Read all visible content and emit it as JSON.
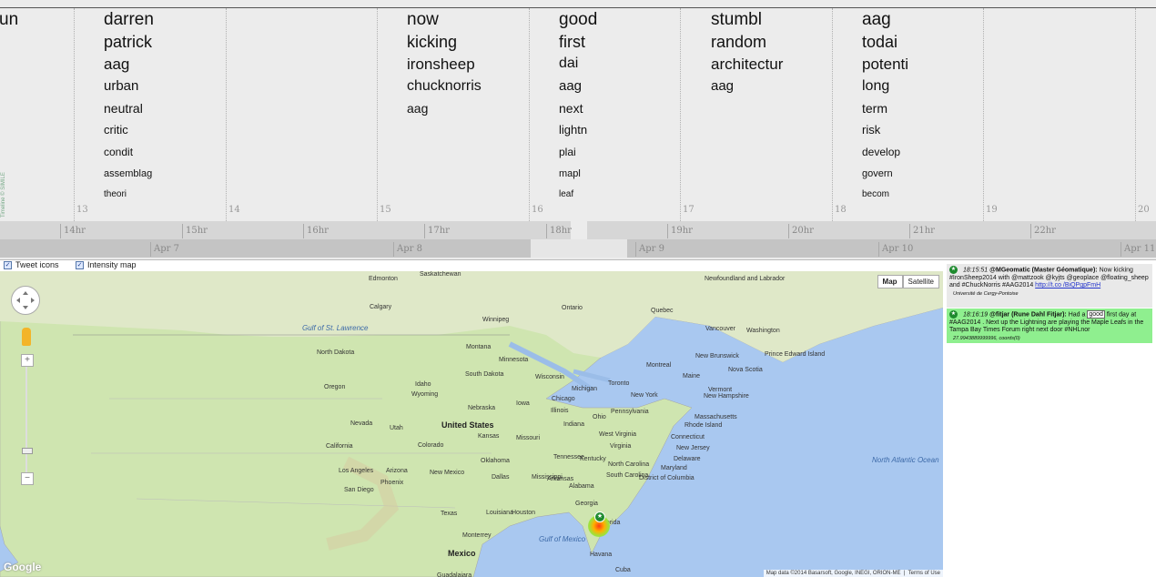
{
  "timeline": {
    "columns": [
      {
        "words": [
          {
            "text": "un",
            "size": 19
          }
        ]
      },
      {
        "words": [
          {
            "text": "darren",
            "size": 19
          },
          {
            "text": "patrick",
            "size": 18
          },
          {
            "text": "aag",
            "size": 17
          },
          {
            "text": "urban",
            "size": 15
          },
          {
            "text": "neutral",
            "size": 14
          },
          {
            "text": "critic",
            "size": 13
          },
          {
            "text": "condit",
            "size": 12
          },
          {
            "text": "assemblag",
            "size": 11
          },
          {
            "text": "theori",
            "size": 10
          }
        ]
      },
      {
        "words": []
      },
      {
        "words": [
          {
            "text": "now",
            "size": 19
          },
          {
            "text": "kicking",
            "size": 18
          },
          {
            "text": "ironsheep",
            "size": 17
          },
          {
            "text": "chucknorris",
            "size": 16
          },
          {
            "text": "aag",
            "size": 14
          }
        ]
      },
      {
        "words": [
          {
            "text": "good",
            "size": 19
          },
          {
            "text": "first",
            "size": 18
          },
          {
            "text": "dai",
            "size": 16
          },
          {
            "text": "aag",
            "size": 15
          },
          {
            "text": "next",
            "size": 14
          },
          {
            "text": "lightn",
            "size": 13
          },
          {
            "text": "plai",
            "size": 12
          },
          {
            "text": "mapl",
            "size": 11
          },
          {
            "text": "leaf",
            "size": 10
          }
        ]
      },
      {
        "words": [
          {
            "text": "stumbl",
            "size": 19
          },
          {
            "text": "random",
            "size": 18
          },
          {
            "text": "architectur",
            "size": 17
          },
          {
            "text": "aag",
            "size": 15
          }
        ]
      },
      {
        "words": [
          {
            "text": "aag",
            "size": 19
          },
          {
            "text": "todai",
            "size": 18
          },
          {
            "text": "potenti",
            "size": 17
          },
          {
            "text": "long",
            "size": 16
          },
          {
            "text": "term",
            "size": 14
          },
          {
            "text": "risk",
            "size": 13
          },
          {
            "text": "develop",
            "size": 12
          },
          {
            "text": "govern",
            "size": 11
          },
          {
            "text": "becom",
            "size": 10
          }
        ]
      }
    ],
    "day_numbers": [
      "13",
      "14",
      "15",
      "16",
      "17",
      "18",
      "19",
      "20"
    ],
    "hours": [
      "14hr",
      "15hr",
      "16hr",
      "17hr",
      "18hr",
      "19hr",
      "20hr",
      "21hr",
      "22hr"
    ],
    "dates": [
      "Apr 7",
      "Apr 8",
      "Apr 9",
      "Apr 10",
      "Apr 11"
    ],
    "credit": "Timeline © SIMILE"
  },
  "controls": {
    "tweet_icons": "Tweet icons",
    "intensity_map": "Intensity map"
  },
  "map": {
    "type_buttons": [
      "Map",
      "Satellite"
    ],
    "zoom_in": "+",
    "zoom_out": "−",
    "attribution": "Map data ©2014 Basarsoft, Google, INEGI, ORION-ME",
    "terms": "Terms of Use",
    "logo": "Google",
    "labels": [
      {
        "text": "Edmonton"
      },
      {
        "text": "Saskatchewan"
      },
      {
        "text": "Newfoundland and Labrador"
      },
      {
        "text": "Calgary"
      },
      {
        "text": "Ontario"
      },
      {
        "text": "Quebec"
      },
      {
        "text": "Winnipeg"
      },
      {
        "text": "Vancouver"
      },
      {
        "text": "Gulf of St. Lawrence"
      },
      {
        "text": "Washington"
      },
      {
        "text": "North Dakota"
      },
      {
        "text": "Montana"
      },
      {
        "text": "Minnesota"
      },
      {
        "text": "Prince Edward Island"
      },
      {
        "text": "New Brunswick"
      },
      {
        "text": "Nova Scotia"
      },
      {
        "text": "Maine"
      },
      {
        "text": "Montreal"
      },
      {
        "text": "Oregon"
      },
      {
        "text": "Idaho"
      },
      {
        "text": "South Dakota"
      },
      {
        "text": "Wisconsin"
      },
      {
        "text": "Toronto"
      },
      {
        "text": "Vermont"
      },
      {
        "text": "New Hampshire"
      },
      {
        "text": "Wyoming"
      },
      {
        "text": "Michigan"
      },
      {
        "text": "New York"
      },
      {
        "text": "Massachusetts"
      },
      {
        "text": "Nebraska"
      },
      {
        "text": "Iowa"
      },
      {
        "text": "Chicago"
      },
      {
        "text": "Pennsylvania"
      },
      {
        "text": "Rhode Island"
      },
      {
        "text": "Nevada"
      },
      {
        "text": "Utah"
      },
      {
        "text": "United States"
      },
      {
        "text": "Illinois"
      },
      {
        "text": "Ohio"
      },
      {
        "text": "Connecticut"
      },
      {
        "text": "California"
      },
      {
        "text": "Colorado"
      },
      {
        "text": "Kansas"
      },
      {
        "text": "Missouri"
      },
      {
        "text": "Indiana"
      },
      {
        "text": "West Virginia"
      },
      {
        "text": "New Jersey"
      },
      {
        "text": "Virginia"
      },
      {
        "text": "Delaware"
      },
      {
        "text": "Kentucky"
      },
      {
        "text": "Maryland"
      },
      {
        "text": "Tennessee"
      },
      {
        "text": "District of Columbia"
      },
      {
        "text": "Oklahoma"
      },
      {
        "text": "Arkansas"
      },
      {
        "text": "North Carolina"
      },
      {
        "text": "Arizona"
      },
      {
        "text": "New Mexico"
      },
      {
        "text": "South Carolina"
      },
      {
        "text": "Los Angeles"
      },
      {
        "text": "Dallas"
      },
      {
        "text": "Mississippi"
      },
      {
        "text": "Alabama"
      },
      {
        "text": "Georgia"
      },
      {
        "text": "San Diego"
      },
      {
        "text": "Phoenix"
      },
      {
        "text": "Texas"
      },
      {
        "text": "Louisiana"
      },
      {
        "text": "Houston"
      },
      {
        "text": "Florida"
      },
      {
        "text": "Monterrey"
      },
      {
        "text": "Gulf of Mexico"
      },
      {
        "text": "Havana"
      },
      {
        "text": "Mexico"
      },
      {
        "text": "Guadalajara"
      },
      {
        "text": "Cuba"
      },
      {
        "text": "North Atlantic Ocean"
      }
    ]
  },
  "tweets": [
    {
      "bg": "#e9e9e9",
      "time": "18:15:51",
      "user": "@MGeomatic (Master Géomatique):",
      "text": "Now kicking #IronSheep2014 with @mattzook @kyjts @geoplace @floating_sheep and #ChuckNorris #AAG2014",
      "link": "http://t.co /BiQPgpFmH",
      "meta": "Université de Cergy-Pontoise"
    },
    {
      "bg": "#8fef8f",
      "time": "18:16:19",
      "user": "@fitjar (Rune Dahl Fitjar):",
      "text_pre": "Had a",
      "highlight": "good",
      "text_post": "first day at #AAG2014 . Next up the Lightning are playing the Maple Leafs in the Tampa Bay Times Forum right next door #NHLnor",
      "meta": "27.9943889999996, coords(0)"
    }
  ]
}
